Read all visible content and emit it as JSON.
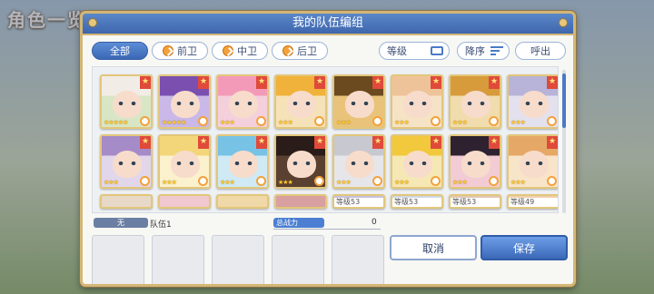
{
  "background": {
    "screen_title": "角色一览"
  },
  "dialog": {
    "title": "我的队伍编组",
    "tabs": [
      {
        "label": "全部",
        "active": true,
        "icon": ""
      },
      {
        "label": "前卫",
        "active": false,
        "icon": "position-icon"
      },
      {
        "label": "中卫",
        "active": false,
        "icon": "position-icon"
      },
      {
        "label": "后卫",
        "active": false,
        "icon": "position-icon"
      }
    ],
    "controls": {
      "level_label": "等级",
      "sort_label": "降序",
      "call_label": "呼出"
    },
    "characters": [
      {
        "bg": "#d9e6c6",
        "hair": "#f2ece6",
        "stars": "★★★★★",
        "rank": "★"
      },
      {
        "bg": "#c9b8e8",
        "hair": "#7a4fb0",
        "stars": "★★★★★",
        "rank": "★"
      },
      {
        "bg": "#f4cfdc",
        "hair": "#f49ab9",
        "stars": "★★★",
        "rank": "★"
      },
      {
        "bg": "#f6e2b8",
        "hair": "#f0b23a",
        "stars": "★★★",
        "rank": "★"
      },
      {
        "bg": "#e9c37a",
        "hair": "#6b4a20",
        "stars": "★★★",
        "rank": "★"
      },
      {
        "bg": "#f6e3c6",
        "hair": "#efc39a",
        "stars": "★★★",
        "rank": "★"
      },
      {
        "bg": "#f1dcae",
        "hair": "#d79b3c",
        "stars": "★★★",
        "rank": "★"
      },
      {
        "bg": "#e4e1ee",
        "hair": "#b8b3d8",
        "stars": "★★★",
        "rank": "★"
      },
      {
        "bg": "#e2d6ea",
        "hair": "#a68bc9",
        "stars": "★★★",
        "rank": "★"
      },
      {
        "bg": "#fbf1cc",
        "hair": "#f3d67a",
        "stars": "★★★",
        "rank": "★"
      },
      {
        "bg": "#cfeaf4",
        "hair": "#78c2e6",
        "stars": "★★★",
        "rank": "★"
      },
      {
        "bg": "#5a4030",
        "hair": "#2a1c18",
        "stars": "★★★",
        "rank": "★"
      },
      {
        "bg": "#e6e6ea",
        "hair": "#c8c8d0",
        "stars": "★★★",
        "rank": "★"
      },
      {
        "bg": "#f6e8b4",
        "hair": "#f2c83c",
        "stars": "★★★",
        "rank": "★"
      },
      {
        "bg": "#f2cbd4",
        "hair": "#2e2230",
        "stars": "★★★",
        "rank": "★"
      },
      {
        "bg": "#f8e4c8",
        "hair": "#e6a866",
        "stars": "★★★",
        "rank": "★"
      }
    ],
    "partial_row": [
      {
        "bg": "#e8d8c8",
        "level": ""
      },
      {
        "bg": "#f0c8d0",
        "level": ""
      },
      {
        "bg": "#f0d8a8",
        "level": ""
      },
      {
        "bg": "#d8a0a0",
        "level": ""
      },
      {
        "bg": "#c8c0e0",
        "level": "等级53"
      },
      {
        "bg": "#d0d8e8",
        "level": "等级53"
      },
      {
        "bg": "#e0c8b8",
        "level": "等级53"
      },
      {
        "bg": "#f0d0b0",
        "level": "等级49"
      }
    ],
    "team": {
      "slot_label": "无",
      "name": "队伍1",
      "power_label": "总战力",
      "power_value": "0"
    },
    "buttons": {
      "cancel": "取消",
      "save": "保存"
    }
  }
}
